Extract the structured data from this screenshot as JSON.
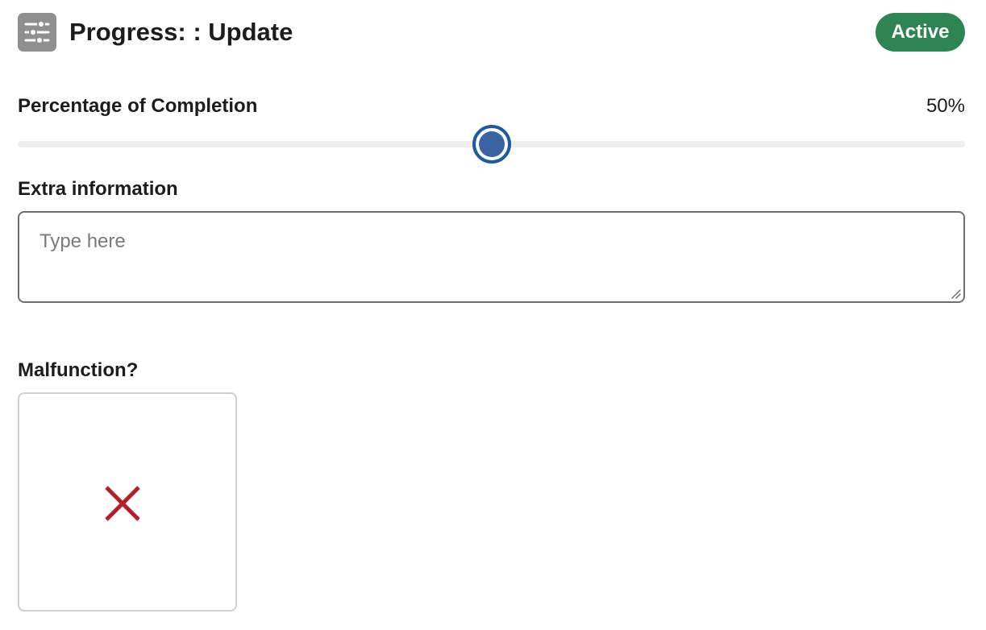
{
  "header": {
    "icon": "sliders-icon",
    "title": "Progress: : Update",
    "status_badge": "Active",
    "status_color": "#2f8552"
  },
  "completion": {
    "label": "Percentage of Completion",
    "value_text": "50%",
    "value": 50,
    "min": 0,
    "max": 100,
    "accent_color": "#1d5aa0"
  },
  "extra_info": {
    "label": "Extra information",
    "value": "",
    "placeholder": "Type here"
  },
  "malfunction": {
    "label": "Malfunction?",
    "state": "no",
    "icon": "x-icon",
    "icon_color": "#b3202a"
  }
}
